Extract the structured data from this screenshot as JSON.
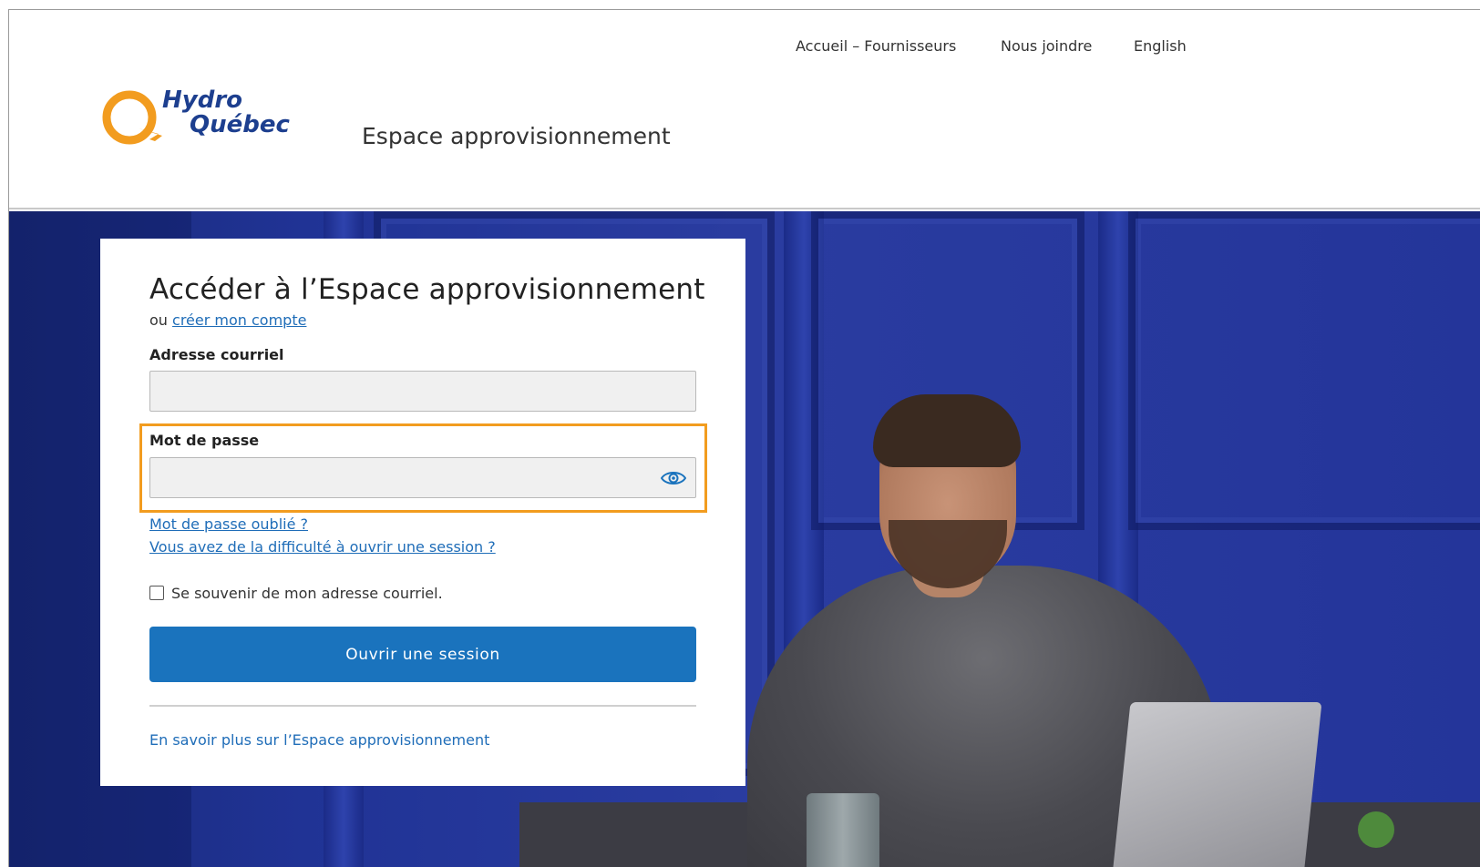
{
  "header": {
    "nav": [
      {
        "label": "Accueil – Fournisseurs"
      },
      {
        "label": "Nous joindre"
      },
      {
        "label": "English"
      }
    ],
    "logo": {
      "line1": "Hydro",
      "line2": "Québec"
    },
    "site_title": "Espace approvisionnement"
  },
  "login": {
    "title": "Accéder à l’Espace approvisionnement",
    "or_prefix": "ou",
    "create_account": "créer mon compte",
    "email_label": "Adresse courriel",
    "email_value": "",
    "password_label": "Mot de passe",
    "password_value": "",
    "forgot_password": "Mot de passe oublié ?",
    "trouble_signin": "Vous avez de la difficulté à ouvrir une session ?",
    "remember_label": "Se souvenir de mon adresse courriel.",
    "remember_checked": false,
    "submit_label": "Ouvrir une session",
    "learn_more": "En savoir plus sur l’Espace approvisionnement"
  },
  "colors": {
    "brand_orange": "#f29c1f",
    "brand_blue": "#1d3f8f",
    "button_blue": "#1a73bd",
    "link_blue": "#1f6db8",
    "hero_blue": "#2a3ca0"
  },
  "icons": {
    "show_password": "eye-icon",
    "logo_mark": "hydro-quebec-logo-icon"
  }
}
